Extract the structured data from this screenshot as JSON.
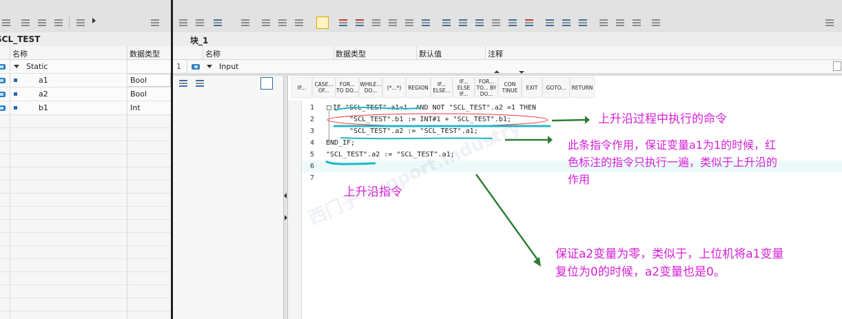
{
  "left_panel": {
    "title": "SCL_TEST",
    "col_name": "名称",
    "col_type": "数据类型",
    "section": "Static",
    "rows": [
      {
        "name": "a1",
        "type": "Bool"
      },
      {
        "name": "a2",
        "type": "Bool"
      },
      {
        "name": "b1",
        "type": "Int"
      }
    ]
  },
  "right_panel": {
    "title": "块_1",
    "col_name": "名称",
    "col_type": "数据类型",
    "col_default": "默认值",
    "col_comment": "注释",
    "first_row_num": "1",
    "first_row_label": "Input"
  },
  "instructions": [
    "IF...",
    "CASE... OF...",
    "FOR... TO DO...",
    "WHILE... DO...",
    "(*...*)",
    "REGION",
    "IF... ELSE...",
    "IF... ELSE IF...",
    "FOR... TO... BY DO...",
    "CON TINUE",
    "EXIT",
    "GOTO...",
    "RETURN"
  ],
  "code_lines": [
    {
      "num": "1",
      "text": "IF \"SCL_TEST\".a1=1  AND NOT \"SCL_TEST\".a2 =1 THEN"
    },
    {
      "num": "2",
      "text": "    \"SCL_TEST\".b1 := INT#1 + \"SCL_TEST\".b1;"
    },
    {
      "num": "3",
      "text": "    \"SCL_TEST\".a2 := \"SCL_TEST\".a1;"
    },
    {
      "num": "4",
      "text": "END_IF;"
    },
    {
      "num": "5",
      "text": "\"SCL_TEST\".a2 := \"SCL_TEST\".a1;"
    },
    {
      "num": "6",
      "text": ""
    },
    {
      "num": "7",
      "text": ""
    }
  ],
  "annotations": {
    "a1": "上升沿过程中执行的命令",
    "a2_l1": "此条指令作用，保证变量a1为1的时候，红",
    "a2_l2": "色标注的指令只执行一遍，类似于上升沿的",
    "a2_l3": "作用",
    "a3": "上升沿指令",
    "a4_l1": "保证a2变量为零，类似于，上位机将a1变量",
    "a4_l2": "复位为0的时候，a2变量也是0。"
  },
  "colors": {
    "annotation": "#d61fd6",
    "arrow": "#2e7d32",
    "highlight": "#22b5c9",
    "red_ellipse": "#e53935"
  }
}
